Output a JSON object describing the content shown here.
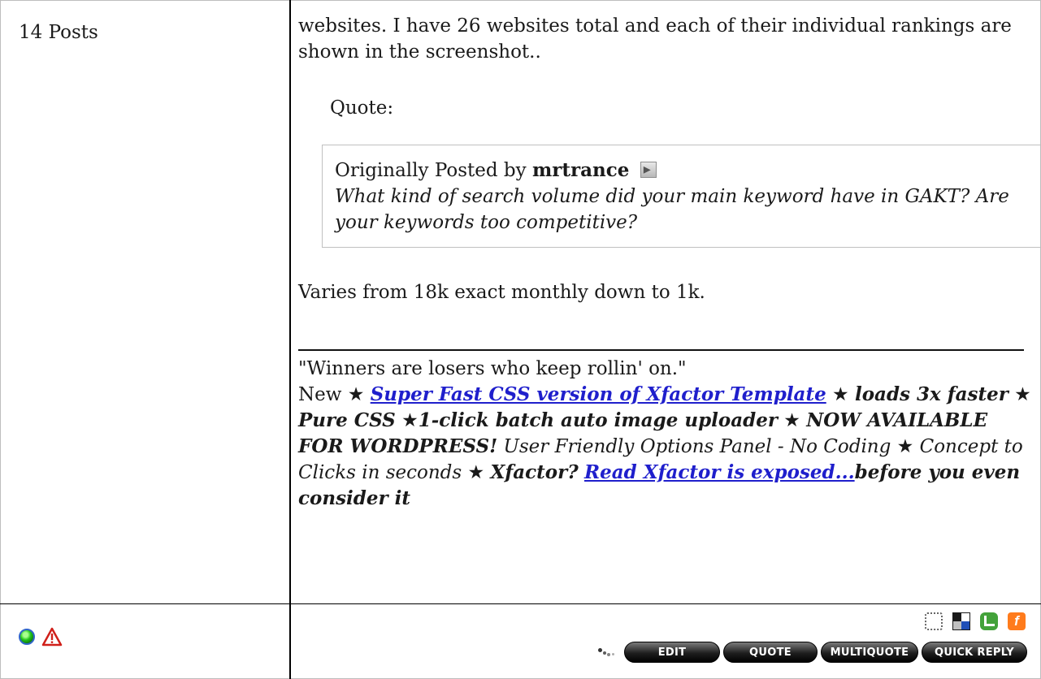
{
  "user_panel": {
    "posts_count": "14 Posts"
  },
  "post": {
    "text": "websites. I have 26 websites total and each of their individual rankings are shown in the screenshot..",
    "quote_label": "Quote:",
    "quote": {
      "prefix": "Originally Posted by",
      "author": "mrtrance",
      "text": "What kind of search volume did your main keyword have in GAKT? Are your keywords too competitive?"
    },
    "reply": "Varies from 18k exact monthly down to 1k."
  },
  "signature": {
    "motto": "\"Winners are losers who keep rollin' on.\"",
    "new_label": "New",
    "star": "★",
    "link1": "Super Fast CSS version of Xfactor Template",
    "part1": "loads 3x faster",
    "part2": "Pure CSS",
    "part3": "1-click batch auto image uploader",
    "part4": "NOW AVAILABLE FOR WORDPRESS!",
    "part5": "User Friendly Options Panel - No Coding",
    "part6": "Concept to Clicks in seconds",
    "part7": "Xfactor?",
    "link2": "Read Xfactor is exposed...",
    "part8": "before you even consider it"
  },
  "status": {
    "online_icon": "online-status-icon",
    "report_icon": "report-post-icon"
  },
  "share_icons": [
    "social-bookmark-icon",
    "delicious-icon",
    "technorati-icon",
    "facebook-icon"
  ],
  "buttons": {
    "edit": "EDIT",
    "quote": "QUOTE",
    "multiquote": "MULTIQUOTE",
    "quick_reply": "QUICK REPLY"
  },
  "colors": {
    "link": "#1f1fcc",
    "button": "#000000",
    "online": "#22c71a",
    "report": "#d0201a"
  }
}
